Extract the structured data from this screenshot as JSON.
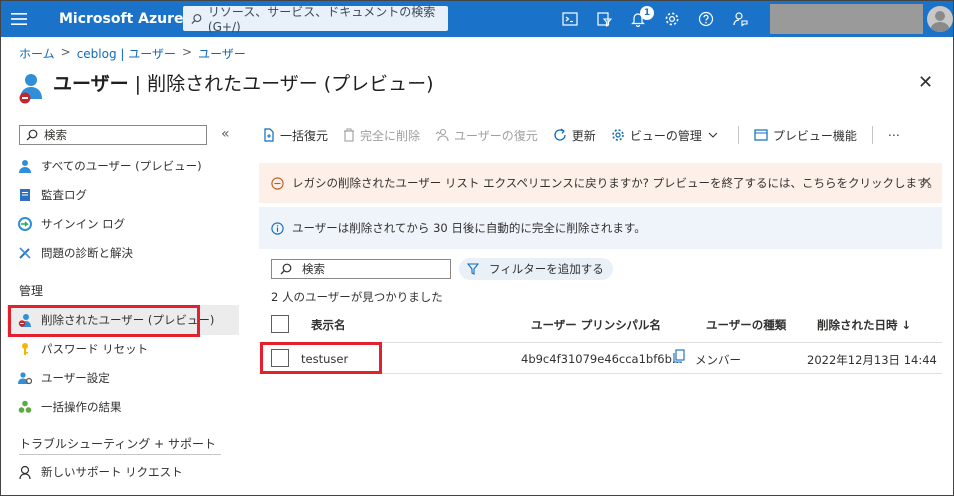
{
  "topbar": {
    "brand": "Microsoft Azure",
    "search_placeholder": "リソース、サービス、ドキュメントの検索 (G+/)",
    "notification_count": "1"
  },
  "breadcrumb": [
    "ホーム",
    "ceblog | ユーザー",
    "ユーザー"
  ],
  "title": {
    "main": "ユーザー",
    "sub": " | 削除されたユーザー (プレビュー)",
    "more": "…",
    "close": "✕"
  },
  "sidebar": {
    "search_placeholder": "検索",
    "collapse": "«",
    "items": [
      {
        "label": "すべてのユーザー (プレビュー)",
        "icon": "user-icon"
      },
      {
        "label": "監査ログ",
        "icon": "log-icon"
      },
      {
        "label": "サインイン ログ",
        "icon": "signin-icon"
      },
      {
        "label": "問題の診断と解決",
        "icon": "wrench-icon"
      }
    ],
    "section_manage": "管理",
    "manage_items": [
      {
        "label": "削除されたユーザー (プレビュー)",
        "icon": "deleted-user-icon"
      },
      {
        "label": "パスワード リセット",
        "icon": "key-icon"
      },
      {
        "label": "ユーザー設定",
        "icon": "user-settings-icon"
      },
      {
        "label": "一括操作の結果",
        "icon": "bulk-icon"
      }
    ],
    "section_support": "トラブルシューティング + サポート",
    "support_items": [
      {
        "label": "新しいサポート リクエスト",
        "icon": "support-icon"
      }
    ]
  },
  "toolbar": {
    "bulk_restore": "一括復元",
    "delete_permanently": "完全に削除",
    "restore_user": "ユーザーの復元",
    "refresh": "更新",
    "view_manage": "ビューの管理",
    "preview_features": "プレビュー機能",
    "more": "⋯"
  },
  "banners": {
    "warning": "レガシの削除されたユーザー リスト エクスペリエンスに戻りますか? プレビューを終了するには、こちらをクリックします。",
    "info": "ユーザーは削除されてから 30 日後に自動的に完全に削除されます。"
  },
  "filter": {
    "search_placeholder": "検索",
    "add_filter": "フィルターを追加する",
    "count_text": "2 人のユーザーが見つかりました"
  },
  "table": {
    "columns": [
      "表示名",
      "ユーザー プリンシパル名",
      "ユーザーの種類",
      "削除された日時 ↓"
    ],
    "rows": [
      {
        "display_name": "testuser",
        "upn": "4b9c4f31079e46cca1bf6b...",
        "type": "メンバー",
        "deleted": "2022年12月13日 14:44"
      }
    ]
  }
}
